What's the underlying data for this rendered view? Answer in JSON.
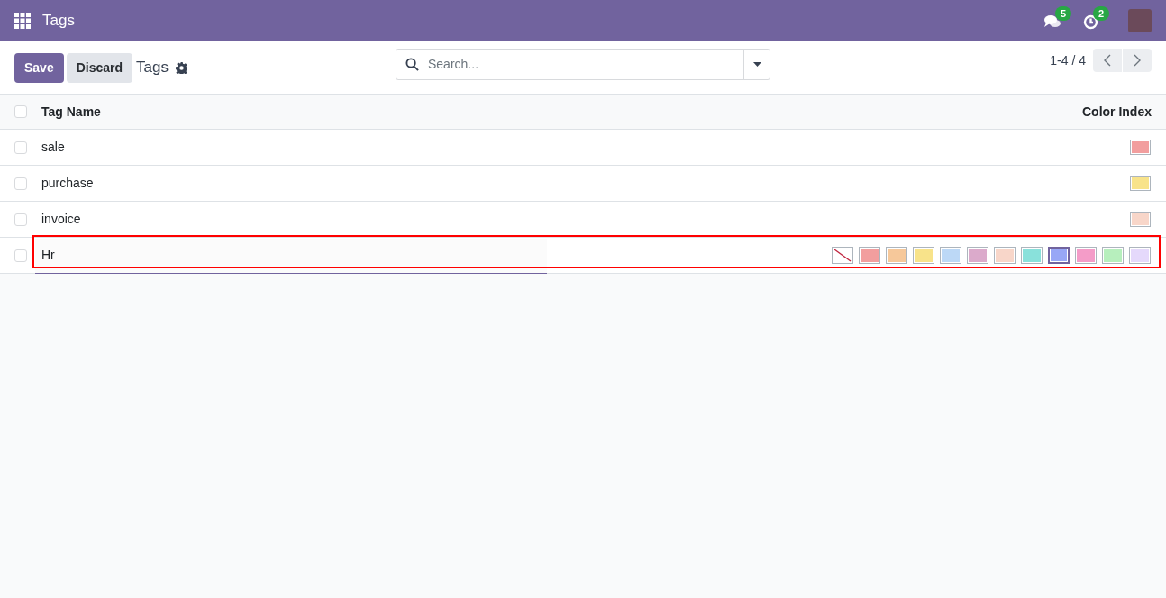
{
  "navbar": {
    "title": "Tags",
    "messages_badge": "5",
    "activities_badge": "2"
  },
  "control_panel": {
    "save": "Save",
    "discard": "Discard",
    "breadcrumb": "Tags",
    "search": {
      "placeholder": "Search..."
    },
    "pager": "1-4 / 4"
  },
  "table": {
    "select_all_checked": false,
    "columns": [
      "Tag Name",
      "Color Index"
    ],
    "rows": [
      {
        "name": "sale",
        "color": "#f29e9e",
        "checked": false
      },
      {
        "name": "purchase",
        "color": "#f8e38a",
        "checked": false
      },
      {
        "name": "invoice",
        "color": "#f8d6c9",
        "checked": false
      }
    ],
    "editing_row": {
      "name": "Hr",
      "checked": false,
      "highlighted": true,
      "swatches": [
        {
          "kind": "none",
          "selected": false
        },
        {
          "kind": "color",
          "color": "#f29e9e",
          "selected": false
        },
        {
          "kind": "color",
          "color": "#f6c89a",
          "selected": false
        },
        {
          "kind": "color",
          "color": "#f8e38a",
          "selected": false
        },
        {
          "kind": "color",
          "color": "#bcd8f6",
          "selected": false
        },
        {
          "kind": "color",
          "color": "#dbaacb",
          "selected": false
        },
        {
          "kind": "color",
          "color": "#f8d6c9",
          "selected": false
        },
        {
          "kind": "color",
          "color": "#89e1db",
          "selected": false
        },
        {
          "kind": "color",
          "color": "#98a7f6",
          "selected": true
        },
        {
          "kind": "color",
          "color": "#f49cc8",
          "selected": false
        },
        {
          "kind": "color",
          "color": "#b7efbd",
          "selected": false
        },
        {
          "kind": "color",
          "color": "#e5d9fb",
          "selected": false
        }
      ]
    }
  }
}
